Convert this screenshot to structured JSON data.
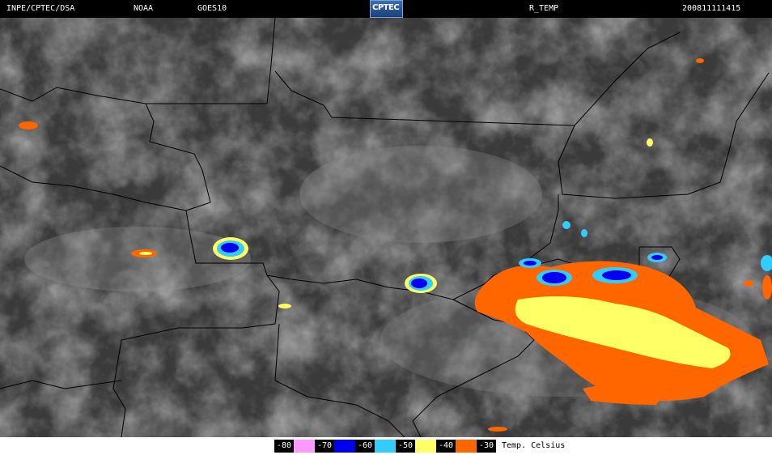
{
  "header": {
    "agency": "INPE/CPTEC/DSA",
    "provider": "NOAA",
    "satellite": "GOES10",
    "logo": "CPTEC",
    "product": "R_TEMP",
    "timestamp": "200811111415"
  },
  "legend": {
    "title": "Temp. Celsius",
    "items": [
      {
        "label": "-80",
        "color": "#ff99ff"
      },
      {
        "label": "-70",
        "color": "#0000ee"
      },
      {
        "label": "-60",
        "color": "#33ccff"
      },
      {
        "label": "-50",
        "color": "#ffff66"
      },
      {
        "label": "-40",
        "color": "#ff6600"
      },
      {
        "label": "-30",
        "color": ""
      }
    ]
  }
}
